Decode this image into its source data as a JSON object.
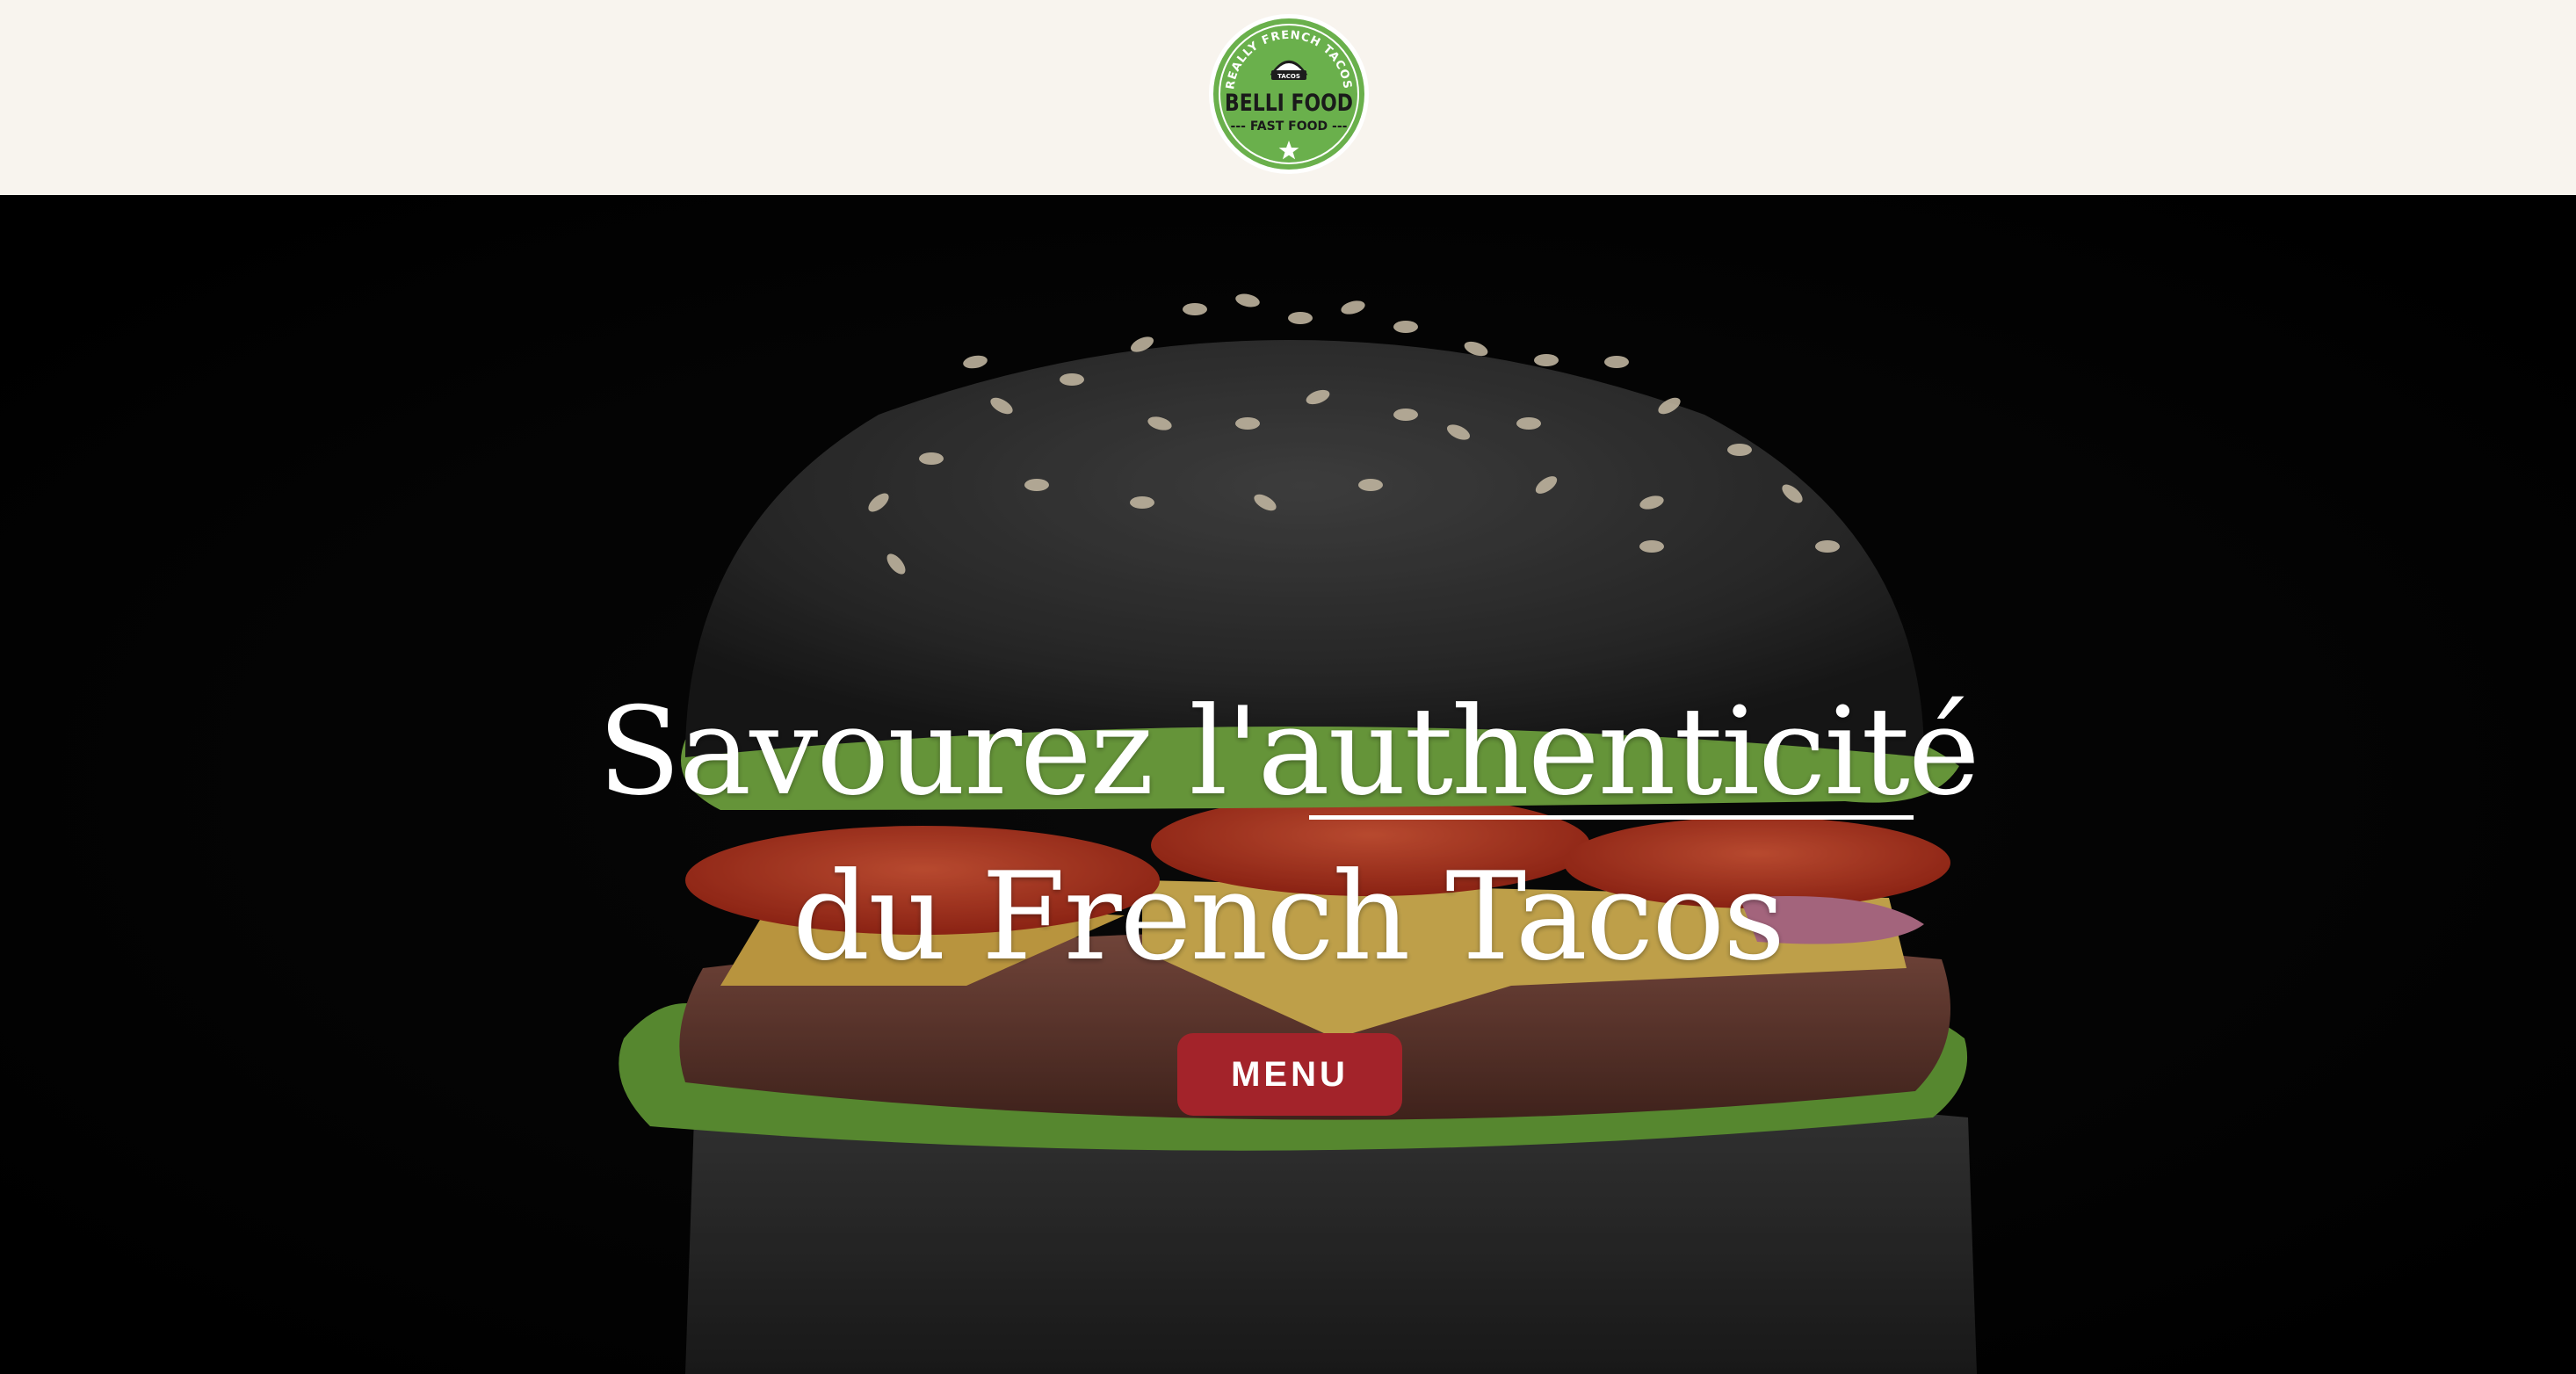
{
  "header": {
    "logo": {
      "top_arc_text": "REALLY FRENCH TACOS",
      "badge_text": "TACOS",
      "brand": "BELLI FOOD",
      "tagline": "--- FAST FOOD ---",
      "ring_color": "#6ab04c",
      "icon": "star-icon"
    }
  },
  "hero": {
    "headline_line1": "Savourez l'authenticité",
    "headline_line2": "du French Tacos",
    "menu_button_label": "MENU",
    "button_color": "#a3232a"
  },
  "colors": {
    "header_background": "#f8f4ee",
    "hero_background": "#000000",
    "text": "#ffffff"
  }
}
